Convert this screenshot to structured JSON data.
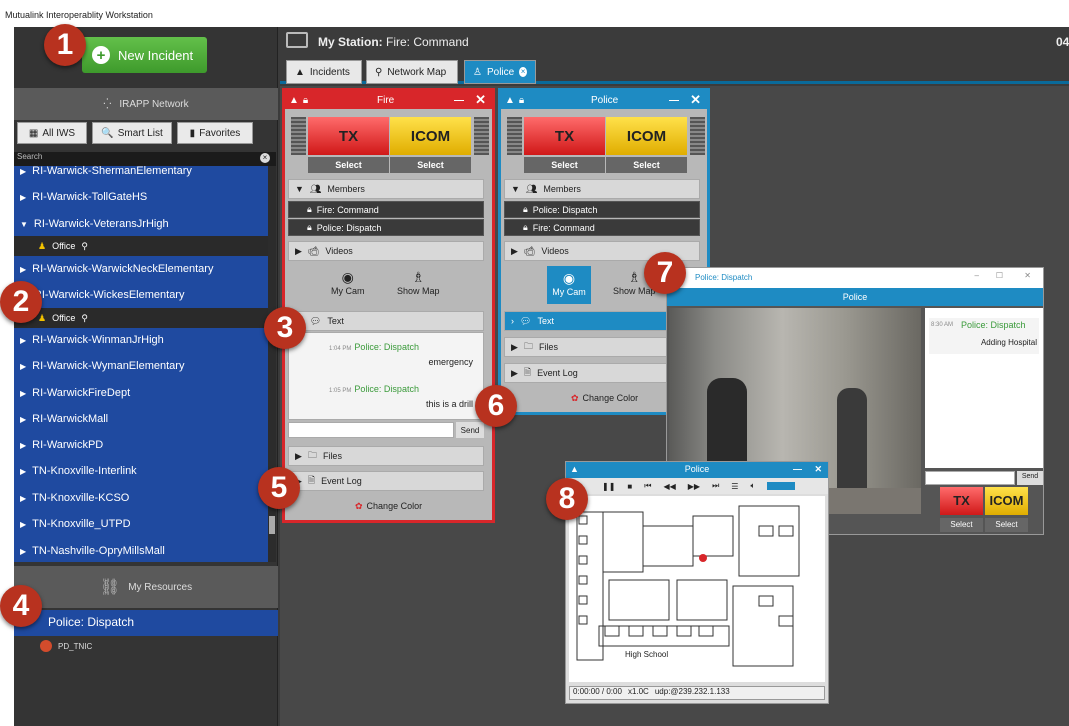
{
  "app": {
    "title": "Mutualink Interoperablity Workstation"
  },
  "left": {
    "new_incident": "New Incident",
    "network": "IRAPP Network",
    "tabs": [
      "All IWS",
      "Smart List",
      "Favorites"
    ],
    "search_placeholder": "Search",
    "tree": [
      {
        "label": "RI-Warwick-ShermanElementary",
        "expanded": false
      },
      {
        "label": "RI-Warwick-TollGateHS",
        "expanded": false
      },
      {
        "label": "RI-Warwick-VeteransJrHigh",
        "expanded": true
      },
      {
        "label": "Office",
        "sub": true
      },
      {
        "label": "RI-Warwick-WarwickNeckElementary",
        "expanded": false
      },
      {
        "label": "RI-Warwick-WickesElementary",
        "expanded": true
      },
      {
        "label": "Office",
        "sub": true
      },
      {
        "label": "RI-Warwick-WinmanJrHigh",
        "expanded": false
      },
      {
        "label": "RI-Warwick-WymanElementary",
        "expanded": false
      },
      {
        "label": "RI-WarwickFireDept",
        "expanded": false
      },
      {
        "label": "RI-WarwickMall",
        "expanded": false
      },
      {
        "label": "RI-WarwickPD",
        "expanded": false
      },
      {
        "label": "TN-Knoxville-Interlink",
        "expanded": false
      },
      {
        "label": "TN-Knoxville-KCSO",
        "expanded": false
      },
      {
        "label": "TN-Knoxville_UTPD",
        "expanded": false
      },
      {
        "label": "TN-Nashville-OpryMillsMall",
        "expanded": false
      }
    ],
    "my_resources": "My Resources",
    "resource_group": "Police: Dispatch",
    "resource_item": "PD_TNIC"
  },
  "station": {
    "label": "My Station:",
    "name": "Fire: Command",
    "clock": "04"
  },
  "tabs": [
    "Incidents",
    "Network Map",
    "Police"
  ],
  "fire_window": {
    "title": "Fire",
    "tx": "TX",
    "icom": "ICOM",
    "select": "Select",
    "members_label": "Members",
    "members": [
      "Fire: Command",
      "Police: Dispatch"
    ],
    "videos_label": "Videos",
    "mycam": "My Cam",
    "showmap": "Show Map",
    "text_label": "Text",
    "messages": [
      {
        "time": "1:04 PM",
        "from": "Police: Dispatch",
        "text": "emergency"
      },
      {
        "time": "1:05 PM",
        "from": "Police: Dispatch",
        "text": "this is a drill"
      }
    ],
    "send": "Send",
    "files": "Files",
    "eventlog": "Event Log",
    "changecolor": "Change Color"
  },
  "police_window": {
    "title": "Police",
    "tx": "TX",
    "icom": "ICOM",
    "select": "Select",
    "members_label": "Members",
    "members": [
      "Police: Dispatch",
      "Fire: Command"
    ],
    "videos_label": "Videos",
    "mycam": "My Cam",
    "showmap": "Show Map",
    "text_label": "Text",
    "files": "Files",
    "eventlog": "Event Log",
    "changecolor": "Change Color"
  },
  "video_window": {
    "title": "Police: Dispatch",
    "incident": "Police",
    "msg_time": "8:30 AM",
    "msg_from": "Police: Dispatch",
    "msg_text": "Adding Hospital",
    "send": "Send",
    "tx": "TX",
    "icom": "ICOM",
    "select": "Select"
  },
  "map_window": {
    "title": "Police",
    "status": "0:00:00 / 0:00",
    "speed": "x1.0C",
    "addr": "udp:@239.232.1.133",
    "map_label": "High School"
  },
  "badges": [
    "1",
    "2",
    "3",
    "4",
    "5",
    "6",
    "7",
    "8"
  ],
  "colors": {
    "fire": "#d8262a",
    "police": "#1e8bc3",
    "tree": "#1f4aa0",
    "green": "#4caf3a"
  }
}
